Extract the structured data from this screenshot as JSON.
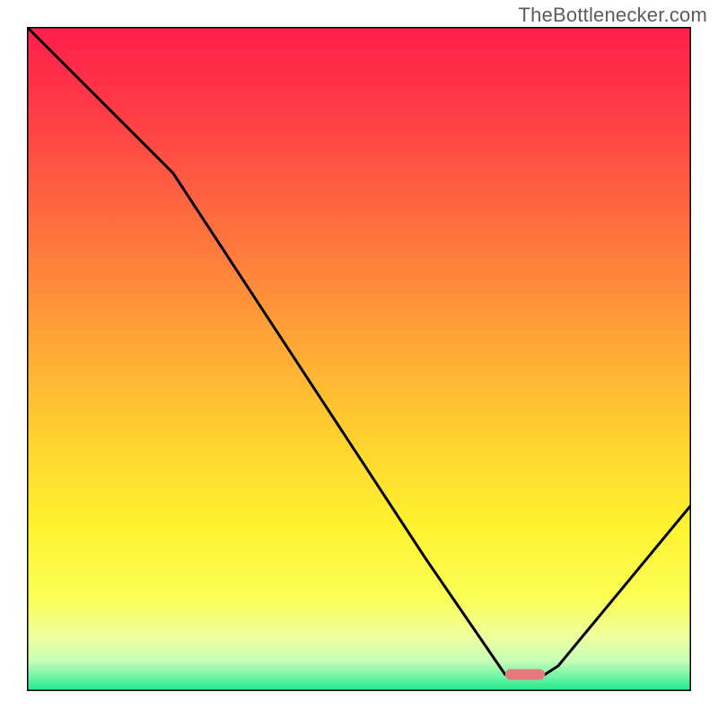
{
  "watermark": "TheBottlenecker.com",
  "chart_data": {
    "type": "line",
    "title": "",
    "xlabel": "",
    "ylabel": "",
    "xlim": [
      0,
      100
    ],
    "ylim": [
      0,
      100
    ],
    "series": [
      {
        "name": "curve",
        "x": [
          0,
          10,
          22,
          60,
          72,
          75,
          78,
          80,
          100
        ],
        "y": [
          100,
          90,
          78,
          20,
          2.5,
          2.5,
          2.5,
          3.8,
          28
        ]
      }
    ],
    "marker": {
      "x_start": 72,
      "x_end": 78,
      "y": 2.5,
      "color": "#e77a7f"
    },
    "background_gradient": {
      "stops": [
        {
          "offset": 0.0,
          "color": "#ff1e4b"
        },
        {
          "offset": 0.12,
          "color": "#ff3a46"
        },
        {
          "offset": 0.3,
          "color": "#ff6f3e"
        },
        {
          "offset": 0.48,
          "color": "#ffa836"
        },
        {
          "offset": 0.62,
          "color": "#ffd22f"
        },
        {
          "offset": 0.75,
          "color": "#fff22f"
        },
        {
          "offset": 0.86,
          "color": "#fbff56"
        },
        {
          "offset": 0.92,
          "color": "#edffa0"
        },
        {
          "offset": 0.955,
          "color": "#c5ffb8"
        },
        {
          "offset": 0.975,
          "color": "#7cf7a6"
        },
        {
          "offset": 1.0,
          "color": "#1ee88b"
        }
      ]
    }
  }
}
